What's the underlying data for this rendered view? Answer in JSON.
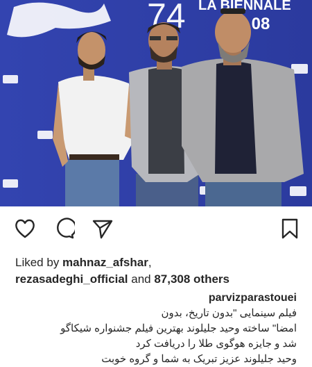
{
  "photo": {
    "banner_text": "LA BIENNALE",
    "banner_number": "74",
    "banner_sub": ".08"
  },
  "actions": {
    "like_icon": "heart-icon",
    "comment_icon": "comment-icon",
    "share_icon": "send-icon",
    "save_icon": "bookmark-icon"
  },
  "likes": {
    "prefix": "Liked by ",
    "user1": "mahnaz_afshar",
    "comma": ",",
    "user2": "rezasadeghi_official",
    "middle": " and ",
    "count": "87,308 others"
  },
  "caption": {
    "username": "parvizparastouei",
    "line1": "فیلم سینمایی \"بدون تاریخ، بدون",
    "line2": "امضا\" ساخته وحید جلیلوند بهترین فیلم جشنواره شیکاگو",
    "line3": "شد و جایزه هوگوی طلا را دریافت کرد",
    "line4": "وحید جلیلوند عزیز تبریک به شما و گروه خوبت"
  },
  "colors": {
    "photo_backdrop": "#2f3fa8",
    "text": "#262626"
  }
}
